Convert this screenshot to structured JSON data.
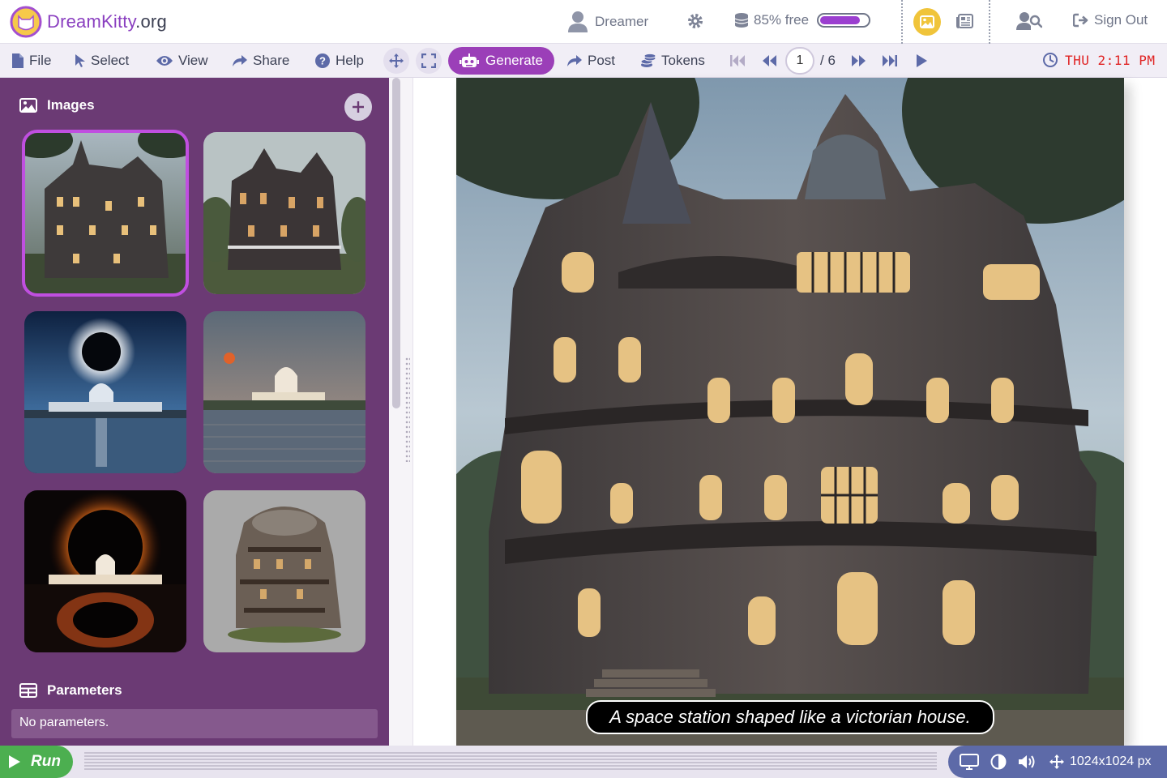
{
  "app": {
    "logo_name": "DreamKitty",
    "logo_tld": ".org",
    "brand_color": "#8a3fc0"
  },
  "header": {
    "user_name": "Dreamer",
    "storage_label": "85% free",
    "storage_used_fraction": 0.85,
    "sign_out_label": "Sign Out",
    "icons": [
      "user-icon",
      "gear-icon",
      "database-icon",
      "image-icon",
      "newspaper-icon",
      "user-search-icon",
      "sign-out-icon"
    ]
  },
  "toolbar": {
    "file_label": "File",
    "select_label": "Select",
    "view_label": "View",
    "share_label": "Share",
    "help_label": "Help",
    "generate_label": "Generate",
    "post_label": "Post",
    "tokens_label": "Tokens",
    "page_current": "1",
    "page_total": "/ 6",
    "clock": "THU 2:11 PM",
    "accent": "#9b3fb8",
    "clock_color": "#e02424"
  },
  "sidebar": {
    "images_title": "Images",
    "parameters_title": "Parameters",
    "parameters_text": "No parameters.",
    "thumbnails": [
      "victorian-space-house-1",
      "victorian-house-2",
      "eclipse-capitol-1",
      "capitol-sunset",
      "eclipse-capitol-2",
      "space-station-house"
    ],
    "selected_index": 0
  },
  "main": {
    "caption": "A space station shaped like a victorian house."
  },
  "footer": {
    "run_label": "Run",
    "dimensions": "1024x1024 px",
    "run_color": "#4caf50",
    "status_color": "#5d6aa8"
  }
}
